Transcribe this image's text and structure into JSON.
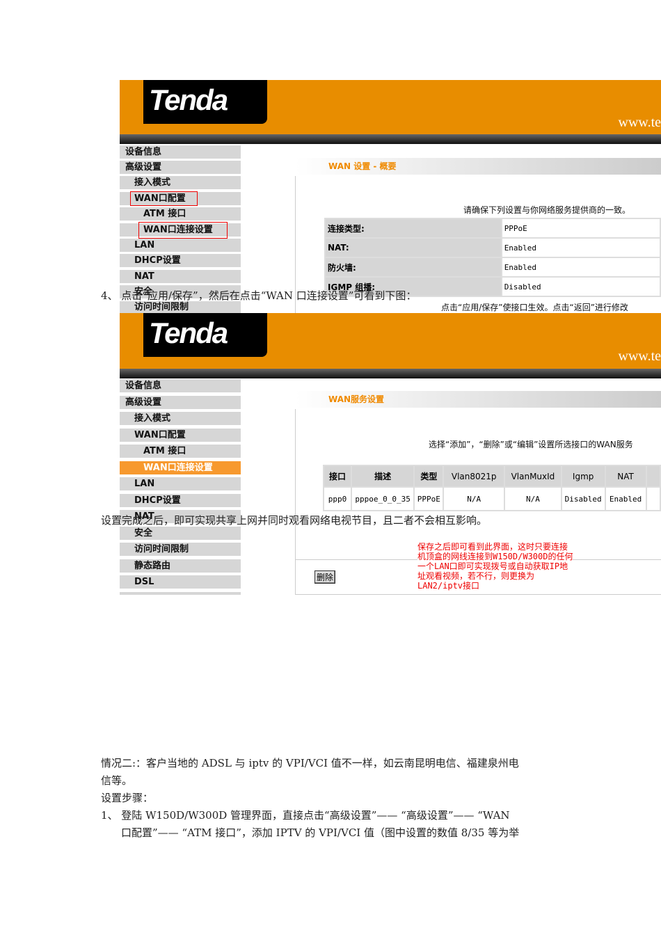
{
  "screens": [
    {
      "logo": "Tenda",
      "url": "www.te",
      "sidebar": [
        "设备信息",
        "高级设置",
        "接入模式",
        "WAN口配置",
        "ATM 接口",
        "WAN口连接设置",
        "LAN",
        "DHCP设置",
        "NAT",
        "安全",
        "访问时间限制"
      ],
      "content_title": "WAN 设置 - 概要",
      "instruction": "请确保下列设置与你网络服务提供商的一致。",
      "summary": [
        {
          "k": "连接类型:",
          "v": "PPPoE"
        },
        {
          "k": "NAT:",
          "v": "Enabled"
        },
        {
          "k": "防火墙:",
          "v": "Enabled"
        },
        {
          "k": "IGMP 组播:",
          "v": "Disabled"
        }
      ],
      "footer_note": "点击“应用/保存”使接口生效。点击“返回”进行修改"
    },
    {
      "logo": "Tenda",
      "url": "www.te",
      "sidebar": [
        "设备信息",
        "高级设置",
        "接入模式",
        "WAN口配置",
        "ATM 接口",
        "WAN口连接设置",
        "LAN",
        "DHCP设置",
        "NAT",
        "安全",
        "访问时间限制",
        "静态路由",
        "DSL"
      ],
      "content_title": "WAN服务设置",
      "instruction": "选择“添加”，“删除”或“编辑”设置所选接口的WAN服务",
      "columns": [
        "接口",
        "描述",
        "类型",
        "Vlan8021p",
        "VlanMuxId",
        "Igmp",
        "NAT"
      ],
      "rows": [
        [
          "ppp0",
          "pppoe_0_0_35",
          "PPPoE",
          "N/A",
          "N/A",
          "Disabled",
          "Enabled"
        ]
      ],
      "delete_button": "删除",
      "annotation": "保存之后即可看到此界面，这时只要连接\n机顶盒的网线连接到W150D/W300D的任何\n一个LAN口即可实现拨号或自动获取IP地\n址观看视频，若不行，则更换为\nLAN2/iptv接口"
    }
  ],
  "doc": {
    "step4": "4、  点击“应用/保存”，然后在点击“WAN 口连接设置”可看到下图：",
    "after": "设置完成之后，即可实现共享上网并同时观看网络电视节目，且二者不会相互影响。",
    "case2_l1": "情况二:：客户当地的 ADSL 与 iptv 的 VPI/VCI 值不一样，如云南昆明电信、福建泉州电",
    "case2_l2": "信等。",
    "steps_title": "设置步骤：",
    "step1_l1": "1、  登陆 W150D/W300D 管理界面，直接点击“高级设置”—— “高级设置”—— “WAN",
    "step1_l2": "口配置”—— “ATM 接口”，添加 IPTV 的 VPI/VCI 值（图中设置的数值 8/35 等为举"
  },
  "colors": {
    "orange": "#e88d00",
    "active": "#f7992e",
    "red": "#e00000"
  }
}
